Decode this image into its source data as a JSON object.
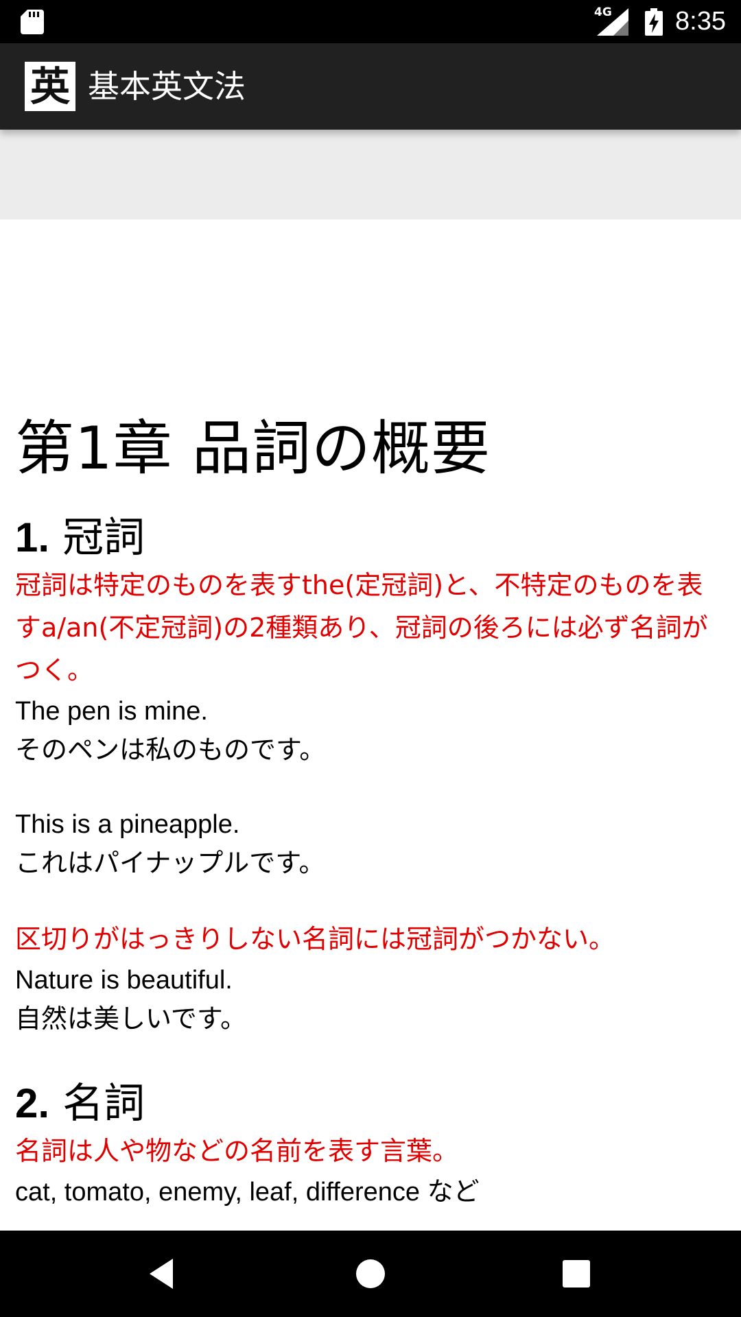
{
  "status_bar": {
    "network": "4G",
    "time": "8:35",
    "icons": [
      "sd-card-icon",
      "signal-icon",
      "battery-charging-icon"
    ]
  },
  "app_bar": {
    "logo": "英",
    "title": "基本英文法"
  },
  "content": {
    "chapter_title": "第1章 品詞の概要",
    "sections": [
      {
        "number": "1.",
        "title": "冠詞",
        "note1": "冠詞は特定のものを表すthe(定冠詞)と、不特定のものを表すa/an(不定冠詞)の2種類あり、冠詞の後ろには必ず名詞がつく。",
        "example1_en": "The pen is mine.",
        "example1_ja": "そのペンは私のものです。",
        "example2_en": "This is a pineapple.",
        "example2_ja": "これはパイナップルです。",
        "note2": "区切りがはっきりしない名詞には冠詞がつかない。",
        "example3_en": "Nature is beautiful.",
        "example3_ja": "自然は美しいです。"
      },
      {
        "number": "2.",
        "title": "名詞",
        "note1": "名詞は人や物などの名前を表す言葉。",
        "example1_en": "cat, tomato, enemy, leaf, difference など"
      }
    ]
  },
  "nav_bar": {
    "icons": [
      "back-icon",
      "home-icon",
      "recents-icon"
    ]
  }
}
